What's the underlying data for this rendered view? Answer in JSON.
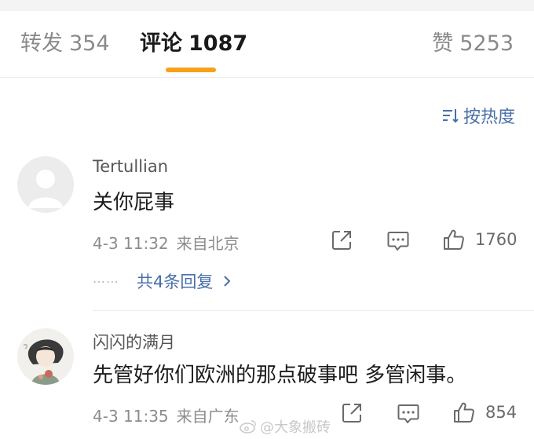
{
  "tabs": [
    {
      "label": "转发",
      "count": "354"
    },
    {
      "label": "评论",
      "count": "1087"
    },
    {
      "label": "赞",
      "count": "5253"
    }
  ],
  "sort": {
    "label": "按热度"
  },
  "comments": [
    {
      "username": "Tertullian",
      "text": "关你屁事",
      "date": "4-3 11:32",
      "source": "来自北京",
      "likes": "1760",
      "replies_dots": "⋯⋯",
      "replies_label": "共4条回复"
    },
    {
      "username": "闪闪的满月",
      "text": "先管好你们欧洲的那点破事吧 多管闲事。",
      "date": "4-3 11:35",
      "source": "来自广东",
      "likes": "854"
    }
  ],
  "watermark": "@大象搬砖",
  "colors": {
    "accent": "#f7a11b",
    "link": "#496fa8"
  }
}
